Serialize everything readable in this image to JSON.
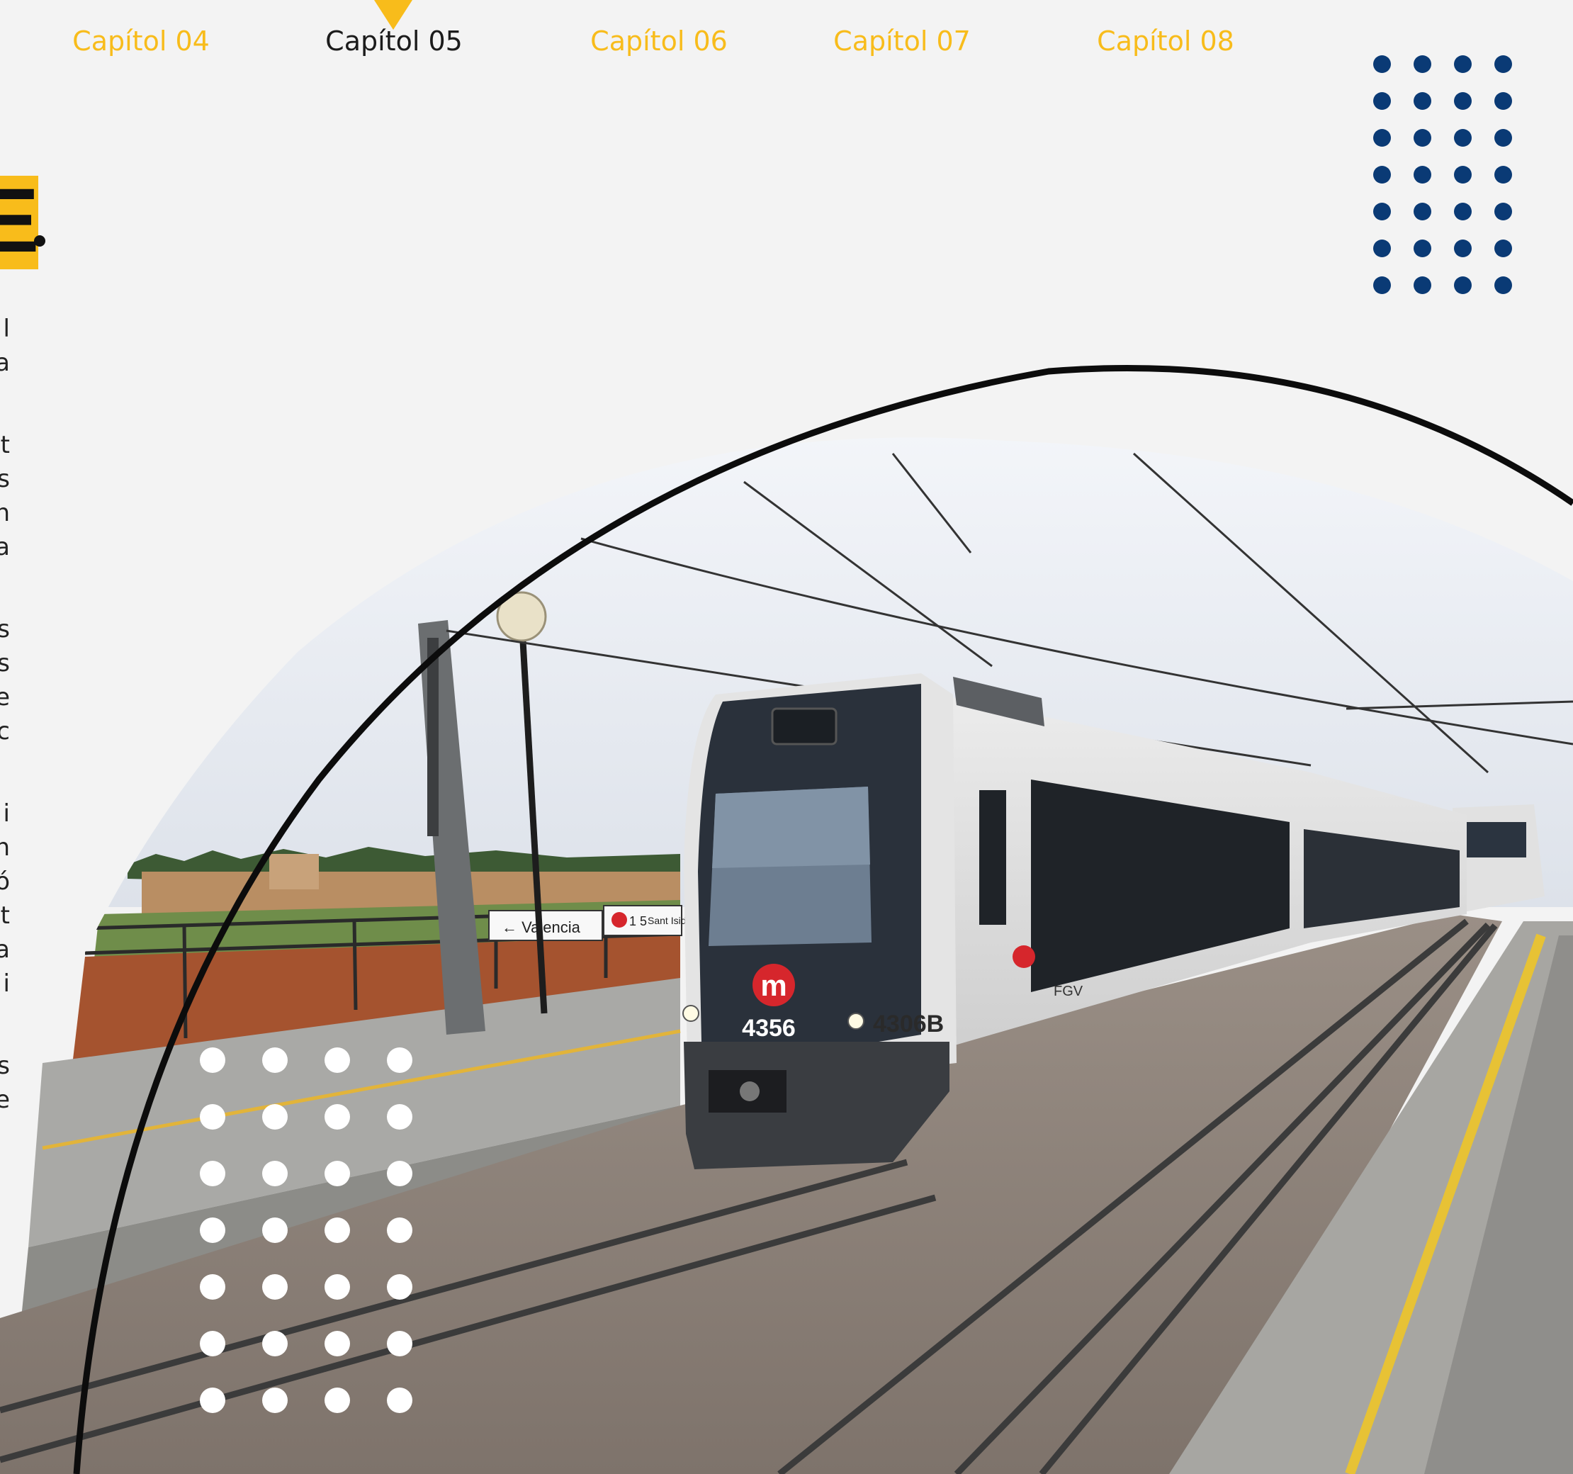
{
  "chapter_nav": {
    "tabs": [
      {
        "label": "Capítol 04",
        "active": false
      },
      {
        "label": "Capítol 05",
        "active": true
      },
      {
        "label": "Capítol 06",
        "active": false
      },
      {
        "label": "Capítol 07",
        "active": false
      },
      {
        "label": "Capítol 08",
        "active": false
      }
    ]
  },
  "title_fragment": "E",
  "body_text_edge_letters": [
    "l",
    "a",
    "t",
    "s",
    "n",
    "a",
    "s",
    "s",
    "e",
    "c",
    "i",
    "n",
    "ó",
    "t",
    "a",
    "i",
    "s",
    "e"
  ],
  "photo": {
    "train_front_number": "4356",
    "train_side_number": "4306B",
    "logo_letter": "m",
    "operator": "FGV",
    "station_sign": "Sant Isidre",
    "direction_sign": "← Valencia",
    "line_badge": "1 5"
  },
  "colors": {
    "accent": "#f8bc1b",
    "navy": "#0a3a75",
    "background": "#f3f3f3",
    "text": "#1b1b1b"
  }
}
